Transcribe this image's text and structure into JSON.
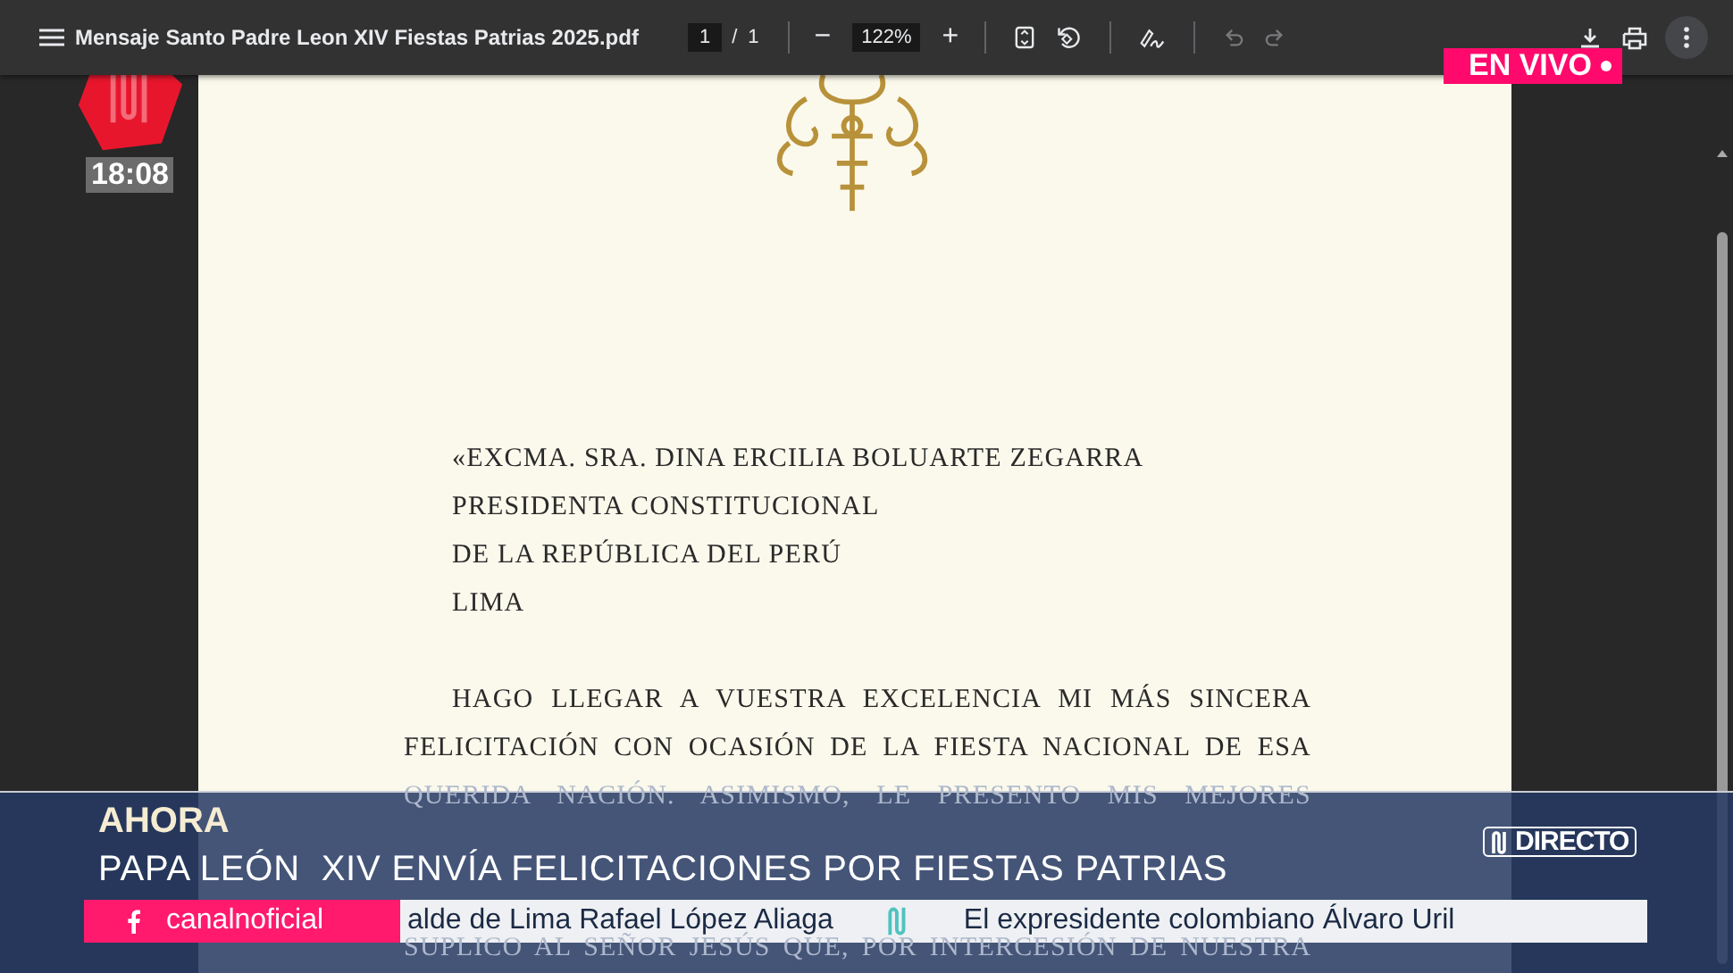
{
  "window": {
    "title": "Mensaje Santo Padre Leon XIV Fiestas Patrias 2025.pdf"
  },
  "toolbar": {
    "page_current": "1",
    "page_separator": "/",
    "page_total": "1",
    "zoom_out": "−",
    "zoom": "122%",
    "zoom_in": "+",
    "tools": [
      {
        "kind": "fit",
        "disabled": false
      },
      {
        "kind": "rotate",
        "disabled": false
      },
      {
        "kind": "sep"
      },
      {
        "kind": "draw",
        "disabled": false
      },
      {
        "kind": "sep"
      },
      {
        "kind": "undo",
        "disabled": true
      },
      {
        "kind": "redo",
        "disabled": true
      }
    ]
  },
  "letter": {
    "address": [
      "«EXCMA. SRA. DINA ERCILIA BOLUARTE ZEGARRA",
      "PRESIDENTA CONSTITUCIONAL",
      "DE LA REPÚBLICA DEL PERÚ",
      "LIMA"
    ],
    "body": [
      {
        "text": "HAGO LLEGAR A VUESTRA EXCELENCIA MI MÁS SINCERA",
        "indent": true,
        "covered": false
      },
      {
        "text": "FELICITACIÓN CON OCASIÓN DE LA FIESTA NACIONAL DE ESA",
        "indent": false,
        "covered": false
      },
      {
        "text": "QUERIDA NACIÓN. ASIMISMO, LE PRESENTO MIS MEJORES",
        "indent": false,
        "covered": true
      },
      {
        "text": "SUPLICO AL SEÑOR JESÚS QUE, POR INTERCESIÓN DE NUESTRA",
        "indent": false,
        "covered": true
      }
    ]
  },
  "overlay": {
    "clock": "18:08",
    "live_badge": "EN VIVO"
  },
  "banner": {
    "label": "AHORA",
    "headline": "PAPA LEÓN  XIV ENVÍA FELICITACIONES POR FIESTAS PATRIAS",
    "brand": "DIRECTO",
    "social": "canalnoficial",
    "ticker": [
      "alde de Lima Rafael López Aliaga",
      "El expresidente colombiano Álvaro Uril"
    ]
  }
}
